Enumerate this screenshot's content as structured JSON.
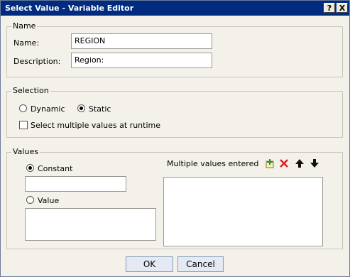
{
  "window": {
    "title": "Select Value - Variable Editor",
    "help_label": "?",
    "close_label": "X"
  },
  "name_group": {
    "legend": "Name",
    "name_label": "Name:",
    "name_value": "REGION",
    "description_label": "Description:",
    "description_value": "Region:"
  },
  "selection_group": {
    "legend": "Selection",
    "dynamic_label": "Dynamic",
    "static_label": "Static",
    "selected_mode": "Static",
    "multiple_label": "Select multiple values at runtime",
    "multiple_checked": false
  },
  "values_group": {
    "legend": "Values",
    "constant_label": "Constant",
    "constant_value": "",
    "value_label": "Value",
    "selected_source": "Constant",
    "multiple_values_label": "Multiple values entered"
  },
  "icons": {
    "add": "add-icon",
    "delete": "delete-icon",
    "up": "arrow-up-icon",
    "down": "arrow-down-icon"
  },
  "buttons": {
    "ok": "OK",
    "cancel": "Cancel"
  }
}
